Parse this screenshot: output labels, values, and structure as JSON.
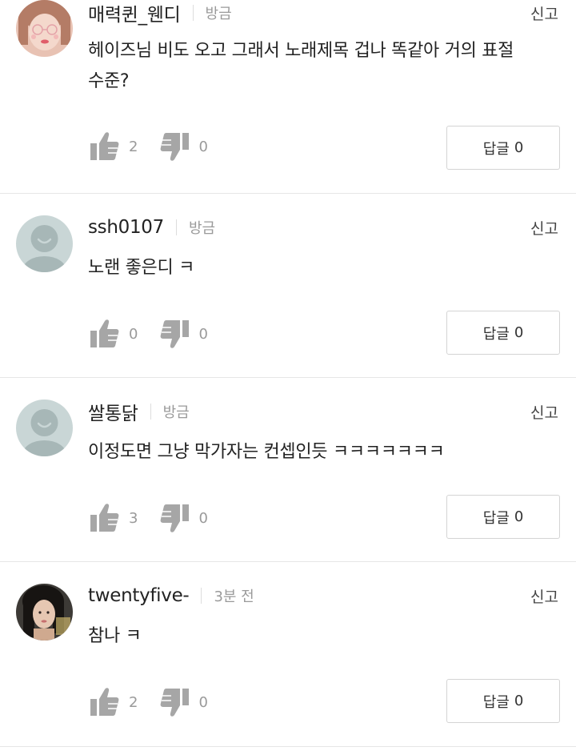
{
  "comments": [
    {
      "username": "매력퀸_웬디",
      "time": "방금",
      "report": "신고",
      "text": "헤이즈님 비도 오고 그래서 노래제목 겁나 똑같아 거의 표절수준?",
      "likes": "2",
      "dislikes": "0",
      "reply_label": "답글",
      "reply_count": "0",
      "avatar": "photo-avatar-girl-glasses"
    },
    {
      "username": "ssh0107",
      "time": "방금",
      "report": "신고",
      "text": "노랜 좋은디 ㅋ",
      "likes": "0",
      "dislikes": "0",
      "reply_label": "답글",
      "reply_count": "0",
      "avatar": "default-avatar"
    },
    {
      "username": "쌀통닭",
      "time": "방금",
      "report": "신고",
      "text": "이정도면 그냥 막가자는 컨셉인듯 ㅋㅋㅋㅋㅋㅋㅋ",
      "likes": "3",
      "dislikes": "0",
      "reply_label": "답글",
      "reply_count": "0",
      "avatar": "default-avatar"
    },
    {
      "username": "twentyfive-",
      "time": "3분 전",
      "report": "신고",
      "text": "참나 ㅋ",
      "likes": "2",
      "dislikes": "0",
      "reply_label": "답글",
      "reply_count": "0",
      "avatar": "photo-avatar-dark"
    }
  ],
  "colors": {
    "icon_gray": "#a6a6a6",
    "default_avatar_bg": "#c9d6d6",
    "default_avatar_fg": "#a7b7b7",
    "divider": "#e6e6e6"
  }
}
